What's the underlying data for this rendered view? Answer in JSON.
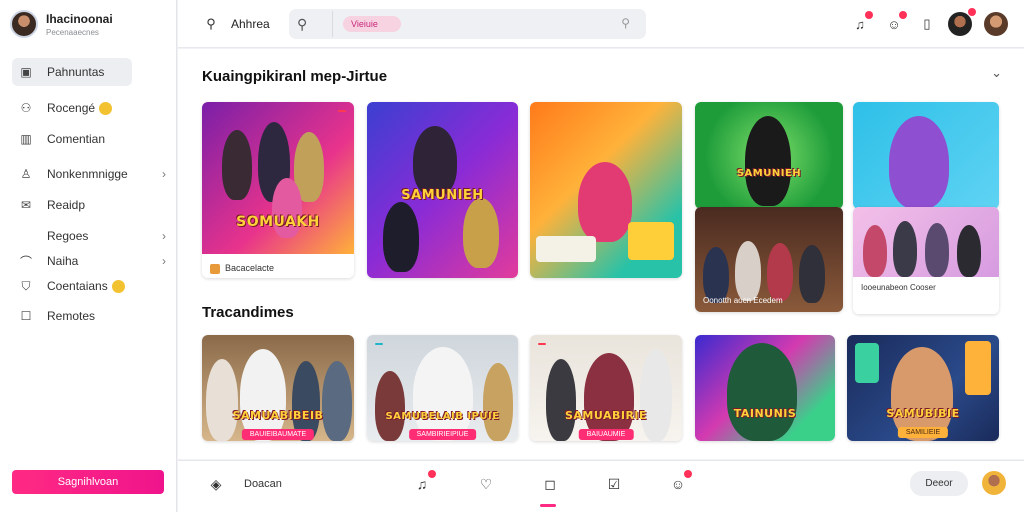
{
  "profile": {
    "name": "Ihacinoonai",
    "subtitle": "Pecenaaecnes"
  },
  "sidebar": {
    "items": [
      {
        "label": "Pahnuntas",
        "icon": "calendar-icon",
        "active": true
      },
      {
        "label": "Rocengé",
        "icon": "people-icon"
      },
      {
        "label": "Comentian",
        "icon": "chart-icon"
      },
      {
        "label": "Nonkenmnigge",
        "icon": "user-icon"
      },
      {
        "label": "Reaidp",
        "icon": "mail-icon"
      },
      {
        "label": "Regoes",
        "icon": ""
      },
      {
        "label": "Naiha",
        "icon": "arch-icon"
      },
      {
        "label": "Coentaians",
        "icon": "shield-icon"
      },
      {
        "label": "Remotes",
        "icon": "list-icon"
      }
    ],
    "cta_label": "Sagnihlvoan"
  },
  "topbar": {
    "title": "Ahhrea",
    "search_value": "Vieiuie",
    "notification_count": "!"
  },
  "sections": {
    "featured_title": "Kuaingpikiranl mep-Jirtue",
    "trending_title": "Tracandimes"
  },
  "featured_cards": [
    {
      "banner": "SOMUAKH",
      "caption": "Bacacelacte"
    },
    {
      "banner": "SAMUNIEH"
    },
    {
      "banner": ""
    },
    {
      "banner": "SAMUNIEH"
    },
    {
      "banner": ""
    },
    {
      "caption": "Oonotth aocn Ecedem"
    },
    {
      "caption": "Iooeunabeon Cooser"
    }
  ],
  "trending_cards": [
    {
      "banner": "SAMUABIBEIB",
      "pill": "BAUIEIBAUMATE"
    },
    {
      "banner": "SAMUBELAIB IPUIE",
      "pill": "SAMBIRIEIPIUE"
    },
    {
      "banner": "SAMUABIRIE",
      "pill": "BAIUAUMIE"
    },
    {
      "banner": "TAINUNIS"
    },
    {
      "banner": "SAMUBIBIE",
      "pill": "SAMILIEIE"
    }
  ],
  "bottombar": {
    "label": "Doacan",
    "button_label": "Deeor"
  }
}
